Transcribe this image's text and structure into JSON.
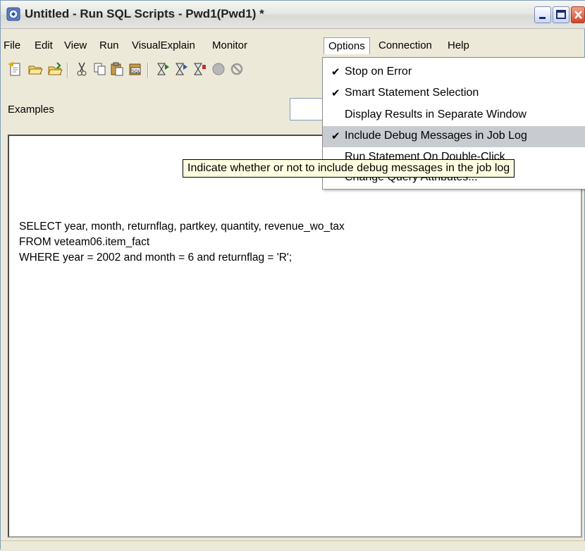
{
  "window": {
    "title": "Untitled - Run SQL Scripts - Pwd1(Pwd1) *"
  },
  "menubar": {
    "items": [
      {
        "label": "File"
      },
      {
        "label": "Edit"
      },
      {
        "label": "View"
      },
      {
        "label": "Run"
      },
      {
        "label": "VisualExplain"
      },
      {
        "label": "Monitor"
      },
      {
        "label": "Options"
      },
      {
        "label": "Connection"
      },
      {
        "label": "Help"
      }
    ],
    "active": "Options"
  },
  "toolbar": {
    "buttons": [
      "new-icon",
      "open-icon",
      "open-from-server-icon",
      "cut-icon",
      "copy-icon",
      "paste-icon",
      "insert-sql-icon",
      "run-all-icon",
      "run-from-selected-icon",
      "run-selected-icon",
      "stop-icon",
      "cancel-icon"
    ]
  },
  "examples": {
    "label": "Examples"
  },
  "options_menu": {
    "items": [
      {
        "label": "Stop on Error",
        "checked": true
      },
      {
        "label": "Smart Statement Selection",
        "checked": true
      },
      {
        "label": "Display Results in Separate Window",
        "checked": false
      },
      {
        "label": "Include Debug Messages in Job Log",
        "checked": true,
        "highlighted": true
      },
      {
        "label": "Run Statement On Double-Click",
        "checked": false
      },
      {
        "label": "Change Query Attributes...",
        "checked": false
      }
    ],
    "check_glyph": "✔"
  },
  "tooltip": {
    "text": "Indicate whether or not to include debug messages in the job log"
  },
  "editor": {
    "lines": [
      "SELECT year, month, returnflag, partkey, quantity, revenue_wo_tax",
      "FROM veteam06.item_fact",
      "WHERE year = 2002 and month = 6 and returnflag = 'R';"
    ]
  },
  "colors": {
    "menu_highlight": "#c8cbd0",
    "tooltip_bg": "#ffffe1",
    "window_bg": "#ece9d8"
  }
}
